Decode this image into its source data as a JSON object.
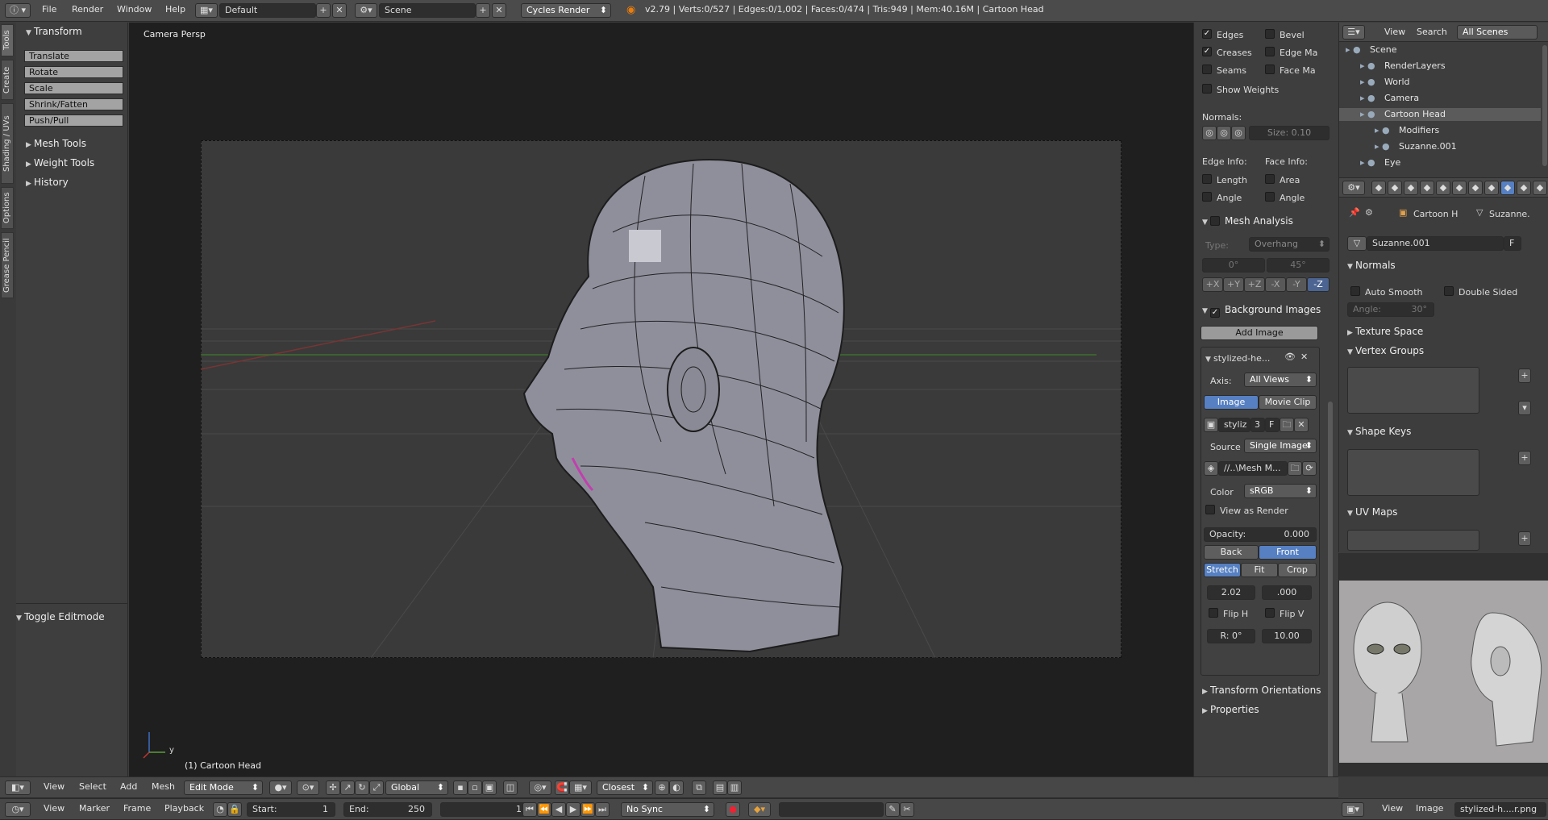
{
  "top_bar": {
    "menus": [
      "File",
      "Render",
      "Window",
      "Help"
    ],
    "layout_name": "Default",
    "scene_name": "Scene",
    "engine": "Cycles Render",
    "stats": "v2.79 | Verts:0/527 | Edges:0/1,002 | Faces:0/474 | Tris:949 | Mem:40.16M | Cartoon Head"
  },
  "tool_tabs": [
    "Tools",
    "Create",
    "Shading / UVs",
    "Options",
    "Grease Pencil"
  ],
  "tool_shelf": {
    "transform_header": "Transform",
    "buttons": [
      "Translate",
      "Rotate",
      "Scale",
      "Shrink/Fatten",
      "Push/Pull"
    ],
    "collapsed": [
      "Mesh Tools",
      "Weight Tools",
      "History"
    ],
    "operator_header": "Toggle Editmode"
  },
  "viewport": {
    "label": "Camera Persp",
    "object_label": "(1) Cartoon Head",
    "axis_y": "y"
  },
  "properties_panel": {
    "checks_col1": [
      "Edges",
      "Creases",
      "Seams",
      "Show Weights"
    ],
    "checks_col1_state": [
      true,
      true,
      false,
      false
    ],
    "checks_col2": [
      "Bevel",
      "Edge Ma",
      "Face Ma"
    ],
    "normals_label": "Normals:",
    "size_field": "Size:  0.10",
    "edge_info_label": "Edge Info:",
    "face_info_label": "Face Info:",
    "edge_info": [
      "Length",
      "Angle"
    ],
    "face_info": [
      "Area",
      "Angle"
    ],
    "mesh_analysis": "Mesh Analysis",
    "type_label": "Type:",
    "type_value": "Overhang",
    "angle_min": "0°",
    "angle_max": "45°",
    "axis_buttons": [
      "+X",
      "+Y",
      "+Z",
      "-X",
      "-Y",
      "-Z"
    ],
    "bg_images": "Background Images",
    "add_image": "Add Image",
    "image_name": "stylized-he...",
    "axis_label": "Axis:",
    "axis_value": "All Views",
    "image_tab": "Image",
    "movie_tab": "Movie Clip",
    "img_field": "styliz",
    "img_users": "3",
    "img_fake": "F",
    "source_label": "Source",
    "source_value": "Single Image",
    "path": "//..\\Mesh M...",
    "color_label": "Color",
    "color_value": "sRGB",
    "view_as_render": "View as Render",
    "opacity": "Opacity:",
    "opacity_value": "0.000",
    "back": "Back",
    "front": "Front",
    "stretch": "Stretch",
    "fit": "Fit",
    "crop": "Crop",
    "offset_x": "2.02",
    "offset_y": ".000",
    "flip_h": "Flip H",
    "flip_v": "Flip V",
    "rotation": "R: 0°",
    "size": "10.00",
    "transform_orient": "Transform Orientations",
    "properties": "Properties"
  },
  "outliner": {
    "view": "View",
    "search": "Search",
    "scope": "All Scenes",
    "rows": [
      {
        "name": "Scene",
        "indent": 0
      },
      {
        "name": "RenderLayers",
        "indent": 1
      },
      {
        "name": "World",
        "indent": 1
      },
      {
        "name": "Camera",
        "indent": 1
      },
      {
        "name": "Cartoon Head",
        "indent": 1
      },
      {
        "name": "Modifiers",
        "indent": 2
      },
      {
        "name": "Suzanne.001",
        "indent": 2
      },
      {
        "name": "Eye",
        "indent": 1
      }
    ]
  },
  "data_props": {
    "breadcrumb_obj": "Cartoon H",
    "breadcrumb_mesh": "Suzanne.",
    "mesh_name": "Suzanne.001",
    "fake_user": "F",
    "normals": "Normals",
    "auto_smooth": "Auto Smooth",
    "double_sided": "Double Sided",
    "angle": "Angle:",
    "angle_value": "30°",
    "texture_space": "Texture Space",
    "vertex_groups": "Vertex Groups",
    "shape_keys": "Shape Keys",
    "uv_maps": "UV Maps"
  },
  "view3d_header": {
    "menus": [
      "View",
      "Select",
      "Add",
      "Mesh"
    ],
    "mode": "Edit Mode",
    "orientation": "Global",
    "snap": "Closest"
  },
  "timeline": {
    "menus": [
      "View",
      "Marker",
      "Frame",
      "Playback"
    ],
    "start": "Start:",
    "start_value": "1",
    "end": "End:",
    "end_value": "250",
    "current": "1",
    "sync": "No Sync"
  },
  "image_editor": {
    "menus": [
      "View",
      "Image"
    ],
    "image_name": "stylized-h....r.png"
  },
  "colors": {
    "accent": "#5680c2",
    "bg": "#3d3d3d",
    "viewport": "#393939",
    "selected_row": "#5b5b5b"
  }
}
